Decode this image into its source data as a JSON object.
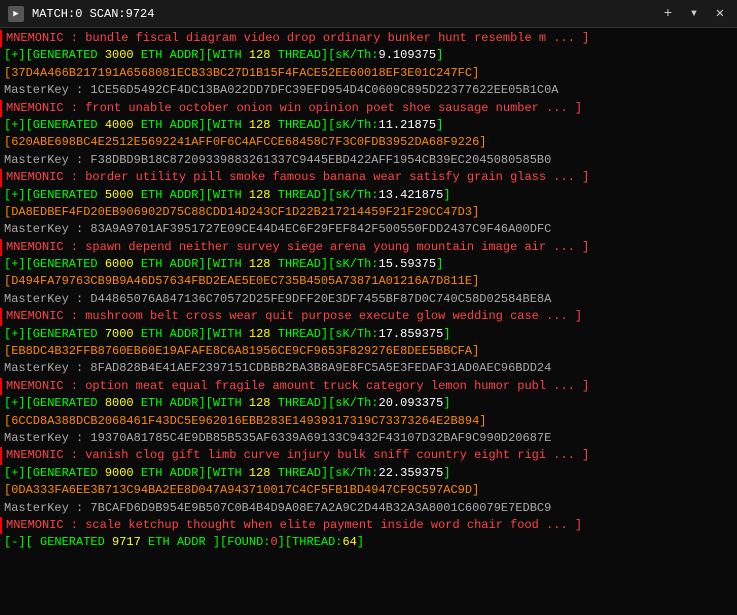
{
  "titleBar": {
    "icon": "▶",
    "text": "MATCH:0 SCAN:9724",
    "closeBtn": "✕",
    "plusBtn": "+",
    "dropBtn": "▾"
  },
  "lines": [
    {
      "type": "mnemonic",
      "text": "MNEMONIC : bundle fiscal diagram video drop ordinary bunker hunt resemble m ... ]"
    },
    {
      "type": "generated",
      "parts": [
        {
          "t": "[+][GENERATED ",
          "c": "green"
        },
        {
          "t": "3000 ",
          "c": "yellow"
        },
        {
          "t": "ETH ADDR][WITH ",
          "c": "green"
        },
        {
          "t": "128 ",
          "c": "yellow"
        },
        {
          "t": "THREAD][sK/Th:",
          "c": "green"
        },
        {
          "t": "9.109375",
          "c": "white"
        },
        {
          "t": "]",
          "c": "green"
        }
      ]
    },
    {
      "type": "addr",
      "text": "[37D4A466B217191A6568081ECB33BC27D1B15F4FACE52EE60018EF3E01C247FC]"
    },
    {
      "type": "masterkey",
      "label": "MasterKey : ",
      "value": "1CE56D5492CF4DC13BA022DD7DFC39EFD954D4C0609C895D22377622EE05B1C0A"
    },
    {
      "type": "mnemonic",
      "text": "MNEMONIC : front unable october onion win opinion poet shoe sausage number ... ]"
    },
    {
      "type": "generated",
      "parts": [
        {
          "t": "[+][GENERATED ",
          "c": "green"
        },
        {
          "t": "4000 ",
          "c": "yellow"
        },
        {
          "t": "ETH ADDR][WITH ",
          "c": "green"
        },
        {
          "t": "128 ",
          "c": "yellow"
        },
        {
          "t": "THREAD][sK/Th:",
          "c": "green"
        },
        {
          "t": "11.21875",
          "c": "white"
        },
        {
          "t": "]",
          "c": "green"
        }
      ]
    },
    {
      "type": "addr",
      "text": "[620ABE698BC4E2512E5692241AFF0F6C4AFCCE68458C7F3C0FDB3952DA68F9226]"
    },
    {
      "type": "masterkey",
      "label": "MasterKey : ",
      "value": "F38DBD9B18C87209339883261337C9445EBD422AFF1954CB39EC2045080585B0"
    },
    {
      "type": "mnemonic",
      "text": "MNEMONIC : border utility pill smoke famous banana wear satisfy grain glass ... ]"
    },
    {
      "type": "generated",
      "parts": [
        {
          "t": "[+][GENERATED ",
          "c": "green"
        },
        {
          "t": "5000 ",
          "c": "yellow"
        },
        {
          "t": "ETH ADDR][WITH ",
          "c": "green"
        },
        {
          "t": "128 ",
          "c": "yellow"
        },
        {
          "t": "THREAD][sK/Th:",
          "c": "green"
        },
        {
          "t": "13.421875",
          "c": "white"
        },
        {
          "t": "]",
          "c": "green"
        }
      ]
    },
    {
      "type": "addr",
      "text": "[DA8EDBEF4FD20EB906902D75C88CDD14D243CF1D22B217214459F21F29CC47D3]"
    },
    {
      "type": "masterkey",
      "label": "MasterKey : ",
      "value": "83A9A9701AF3951727E09CE44D4EC6F29FEF842F500550FDD2437C9F46A00DFC"
    },
    {
      "type": "mnemonic",
      "text": "MNEMONIC : spawn depend neither survey siege arena young mountain image air ... ]"
    },
    {
      "type": "generated",
      "parts": [
        {
          "t": "[+][GENERATED ",
          "c": "green"
        },
        {
          "t": "6000 ",
          "c": "yellow"
        },
        {
          "t": "ETH ADDR][WITH ",
          "c": "green"
        },
        {
          "t": "128 ",
          "c": "yellow"
        },
        {
          "t": "THREAD][sK/Th:",
          "c": "green"
        },
        {
          "t": "15.59375",
          "c": "white"
        },
        {
          "t": "]",
          "c": "green"
        }
      ]
    },
    {
      "type": "addr",
      "text": "[D494FA79763CB9B9A46D57634FBD2EAE5E0EC735B4505A73871A01216A7D811E]"
    },
    {
      "type": "masterkey",
      "label": "MasterKey : ",
      "value": "D44865076A847136C70572D25FE9DFF20E3DF7455BF87D0C740C58D02584BE8A"
    },
    {
      "type": "mnemonic",
      "text": "MNEMONIC : mushroom belt cross wear quit purpose execute glow wedding case ... ]"
    },
    {
      "type": "generated",
      "parts": [
        {
          "t": "[+][GENERATED ",
          "c": "green"
        },
        {
          "t": "7000 ",
          "c": "yellow"
        },
        {
          "t": "ETH ADDR][WITH ",
          "c": "green"
        },
        {
          "t": "128 ",
          "c": "yellow"
        },
        {
          "t": "THREAD][sK/Th:",
          "c": "green"
        },
        {
          "t": "17.859375",
          "c": "white"
        },
        {
          "t": "]",
          "c": "green"
        }
      ]
    },
    {
      "type": "addr",
      "text": "[EB8DC4B32FFB8760EB60E19AFAFE8C6A81956CE9CF9653F829276E8DEE5BBCFA]"
    },
    {
      "type": "masterkey",
      "label": "MasterKey : ",
      "value": "8FAD828B4E41AEF2397151CDBBB2BA3B8A9E8FC5A5E3FEDAF31AD0AEC96BDD24"
    },
    {
      "type": "mnemonic",
      "text": "MNEMONIC : option meat equal fragile amount truck category lemon humor publ ... ]"
    },
    {
      "type": "generated",
      "parts": [
        {
          "t": "[+][GENERATED ",
          "c": "green"
        },
        {
          "t": "8000 ",
          "c": "yellow"
        },
        {
          "t": "ETH ADDR][WITH ",
          "c": "green"
        },
        {
          "t": "128 ",
          "c": "yellow"
        },
        {
          "t": "THREAD][sK/Th:",
          "c": "green"
        },
        {
          "t": "20.093375",
          "c": "white"
        },
        {
          "t": "]",
          "c": "green"
        }
      ]
    },
    {
      "type": "addr",
      "text": "[6CCD8A388DCB2068461F43DC5E962016EBB283E14939317319C73373264E2B894]"
    },
    {
      "type": "masterkey",
      "label": "MasterKey : ",
      "value": "19370A81785C4E9DB85B535AF6339A69133C9432F43107D32BAF9C990D20687E"
    },
    {
      "type": "mnemonic",
      "text": "MNEMONIC : vanish clog gift limb curve injury bulk sniff country eight rigi ... ]"
    },
    {
      "type": "generated",
      "parts": [
        {
          "t": "[+][GENERATED ",
          "c": "green"
        },
        {
          "t": "9000 ",
          "c": "yellow"
        },
        {
          "t": "ETH ADDR][WITH ",
          "c": "green"
        },
        {
          "t": "128 ",
          "c": "yellow"
        },
        {
          "t": "THREAD][sK/Th:",
          "c": "green"
        },
        {
          "t": "22.359375",
          "c": "white"
        },
        {
          "t": "]",
          "c": "green"
        }
      ]
    },
    {
      "type": "addr",
      "text": "[0DA333FA6EE3B713C94BA2EE8D047A943710017C4CF5FB1BD4947CF9C597AC9D]"
    },
    {
      "type": "masterkey",
      "label": "MasterKey : ",
      "value": "7BCAFD6D9B954E9B507C0B4B4D9A08E7A2A9C2D44B32A3A8001C60079E7EDBC9"
    },
    {
      "type": "mnemonic",
      "text": "MNEMONIC : scale ketchup thought when elite payment inside word chair food ... ]"
    },
    {
      "type": "status",
      "parts": [
        {
          "t": "[-][ GENERATED ",
          "c": "green"
        },
        {
          "t": "9717 ",
          "c": "yellow"
        },
        {
          "t": "ETH ADDR ",
          "c": "green"
        },
        {
          "t": "][FOUND:",
          "c": "green"
        },
        {
          "t": "0",
          "c": "red"
        },
        {
          "t": "][THREAD:",
          "c": "green"
        },
        {
          "t": "64",
          "c": "yellow"
        },
        {
          "t": "]",
          "c": "green"
        }
      ]
    }
  ]
}
